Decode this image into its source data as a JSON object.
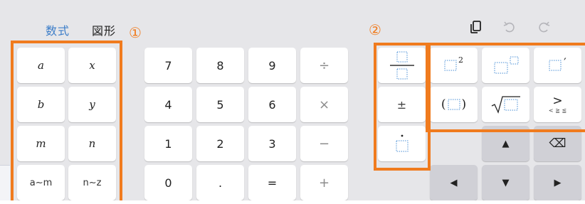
{
  "tabs": {
    "math": "数式",
    "geometry": "図形"
  },
  "annotations": {
    "one": "①",
    "two": "②"
  },
  "colors": {
    "accent": "#3d7ec9",
    "highlight": "#f07b1e",
    "panel": "#e6e6e9",
    "key": "#ffffff",
    "arrow_key": "#d0d0d6"
  },
  "toolbar": {
    "icons": [
      "copy-icon",
      "undo-icon",
      "redo-icon"
    ]
  },
  "variables": {
    "a": "a",
    "x": "x",
    "b": "b",
    "y": "y",
    "m": "m",
    "n": "n",
    "range_am": "a∼m",
    "range_nz": "n∼z"
  },
  "numpad": {
    "seven": "7",
    "eight": "8",
    "nine": "9",
    "divide": "÷",
    "four": "4",
    "five": "5",
    "six": "6",
    "multiply": "×",
    "one": "1",
    "two": "2",
    "three": "3",
    "minus": "−",
    "zero": "0",
    "dot": ".",
    "equals": "=",
    "plus": "+"
  },
  "templates": {
    "superscript_two": "2",
    "plus_minus": "±",
    "prime": "′",
    "greater": ">",
    "compare_options": "< ≧ ≦",
    "open_paren": "(",
    "close_paren": ")"
  },
  "arrows": {
    "up": "▲",
    "down": "▼",
    "left": "◀",
    "right": "▶",
    "backspace": "⌫"
  }
}
